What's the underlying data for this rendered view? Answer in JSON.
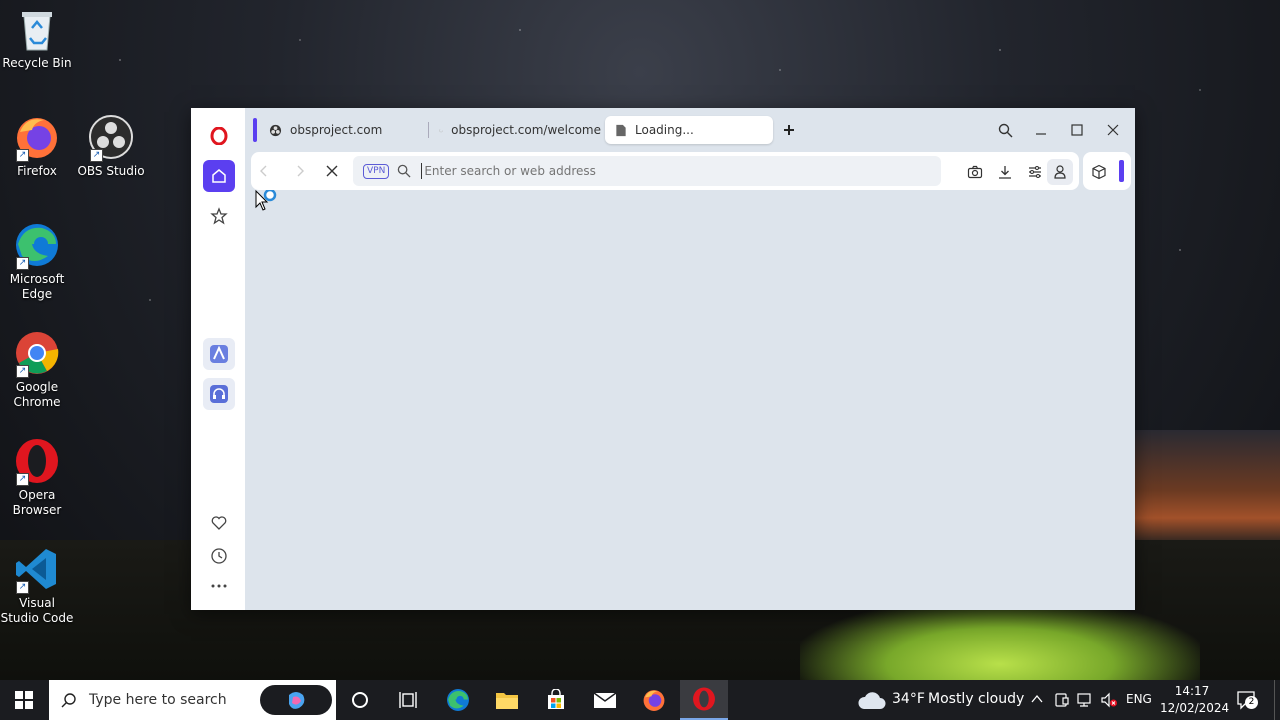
{
  "desktop": {
    "icons": [
      {
        "label": "Recycle Bin"
      },
      {
        "label": "Firefox"
      },
      {
        "label": "OBS Studio"
      },
      {
        "label": "Microsoft Edge"
      },
      {
        "label": "Google Chrome"
      },
      {
        "label": "Opera Browser"
      },
      {
        "label": "Visual Studio Code"
      }
    ]
  },
  "browser": {
    "tabs": [
      {
        "label": "obsproject.com"
      },
      {
        "label": "obsproject.com/welcome"
      },
      {
        "label": "Loading..."
      }
    ],
    "vpn_label": "VPN",
    "address_placeholder": "Enter search or web address",
    "accent_color": "#5b3ff0"
  },
  "taskbar": {
    "search_placeholder": "Type here to search",
    "weather_temp": "34°F",
    "weather_text": "Mostly cloudy",
    "language": "ENG",
    "time": "14:17",
    "date": "12/02/2024",
    "notification_count": "2"
  }
}
